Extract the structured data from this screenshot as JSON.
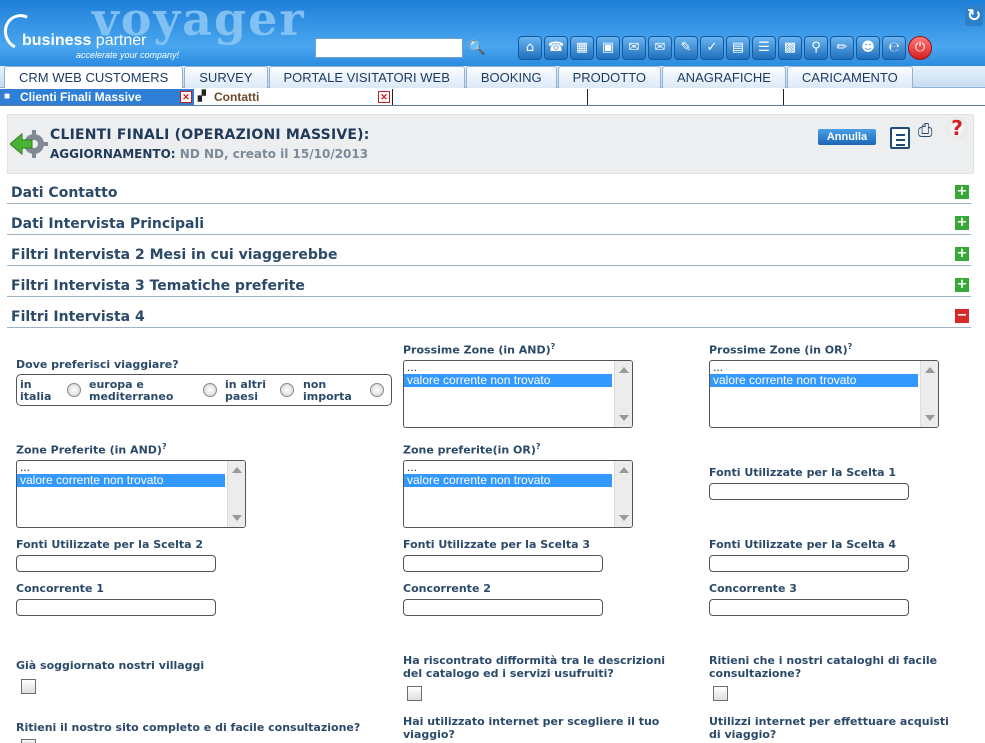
{
  "header": {
    "brand": "voyager",
    "company_bold": "business",
    "company_rest": " partner",
    "tagline": "accelerate your company!",
    "search_value": "",
    "toolbar_icons": [
      "home-icon",
      "phone-icon",
      "calendar-add-icon",
      "calendar-icon",
      "mail-in-icon",
      "mail-out-icon",
      "pen-icon",
      "checklist-icon",
      "briefcase-icon",
      "document-list-icon",
      "calculator-icon",
      "search-icon",
      "edit-icon",
      "users-icon",
      "internet-icon",
      "power-icon"
    ]
  },
  "nav": {
    "tabs": [
      "CRM WEB CUSTOMERS",
      "SURVEY",
      "PORTALE VISITATORI WEB",
      "BOOKING",
      "PRODOTTO",
      "ANAGRAFICHE",
      "CARICAMENTO"
    ]
  },
  "doc_tabs": [
    {
      "label": "Clienti Finali Massive"
    },
    {
      "label": "Contatti"
    }
  ],
  "page": {
    "title": "CLIENTI FINALI (OPERAZIONI MASSIVE):",
    "subtitle_label": "AGGIORNAMENTO:",
    "subtitle_value": "ND ND, creato il 15/10/2013",
    "annulla": "Annulla"
  },
  "sections": [
    {
      "label": "Dati Contatto",
      "toggle": "+"
    },
    {
      "label": "Dati Intervista Principali",
      "toggle": "+"
    },
    {
      "label": "Filtri Intervista 2 Mesi in cui viaggerebbe",
      "toggle": "+"
    },
    {
      "label": "Filtri Intervista 3 Tematiche preferite",
      "toggle": "+"
    },
    {
      "label": "Filtri Intervista 4",
      "toggle": "−"
    }
  ],
  "form": {
    "dove_label": "Dove preferisci viaggiare?",
    "dove_options": [
      {
        "line1": "in",
        "line2": "italia"
      },
      {
        "line1": "europa e",
        "line2": "mediterraneo"
      },
      {
        "line1": "in altri",
        "line2": "paesi"
      },
      {
        "line1": "non",
        "line2": "importa"
      }
    ],
    "prossime_and_label": "Prossime Zone (in AND)",
    "prossime_or_label": "Prossime Zone (in OR)",
    "zone_pref_and_label": "Zone Preferite (in AND)",
    "zone_pref_or_label": "Zone preferite(in OR)",
    "list_opt_dots": "...",
    "list_opt_value": "valore corrente non trovato",
    "fonti1_label": "Fonti Utilizzate per la Scelta 1",
    "fonti2_label": "Fonti Utilizzate per la Scelta 2",
    "fonti3_label": "Fonti Utilizzate per la Scelta 3",
    "fonti4_label": "Fonti Utilizzate per la Scelta 4",
    "conc1_label": "Concorrente 1",
    "conc2_label": "Concorrente 2",
    "conc3_label": "Concorrente 3",
    "gia_label": "Già soggiornato nostri villaggi",
    "difformita_line1": "Ha riscontrato difformità tra le descrizioni",
    "difformita_line2": "del catalogo ed i servizi usufruiti?",
    "cataloghi_line1": "Ritieni che i nostri cataloghi di facile",
    "cataloghi_line2": "consultazione?",
    "sito_label": "Ritieni il nostro sito completo e di facile consultazione?",
    "internet_line1": "Hai utilizzato internet per scegliere il tuo",
    "internet_line2": "viaggio?",
    "acquisti_line1": "Utilizzi internet per effettuare acquisti",
    "acquisti_line2": "di viaggio?"
  }
}
